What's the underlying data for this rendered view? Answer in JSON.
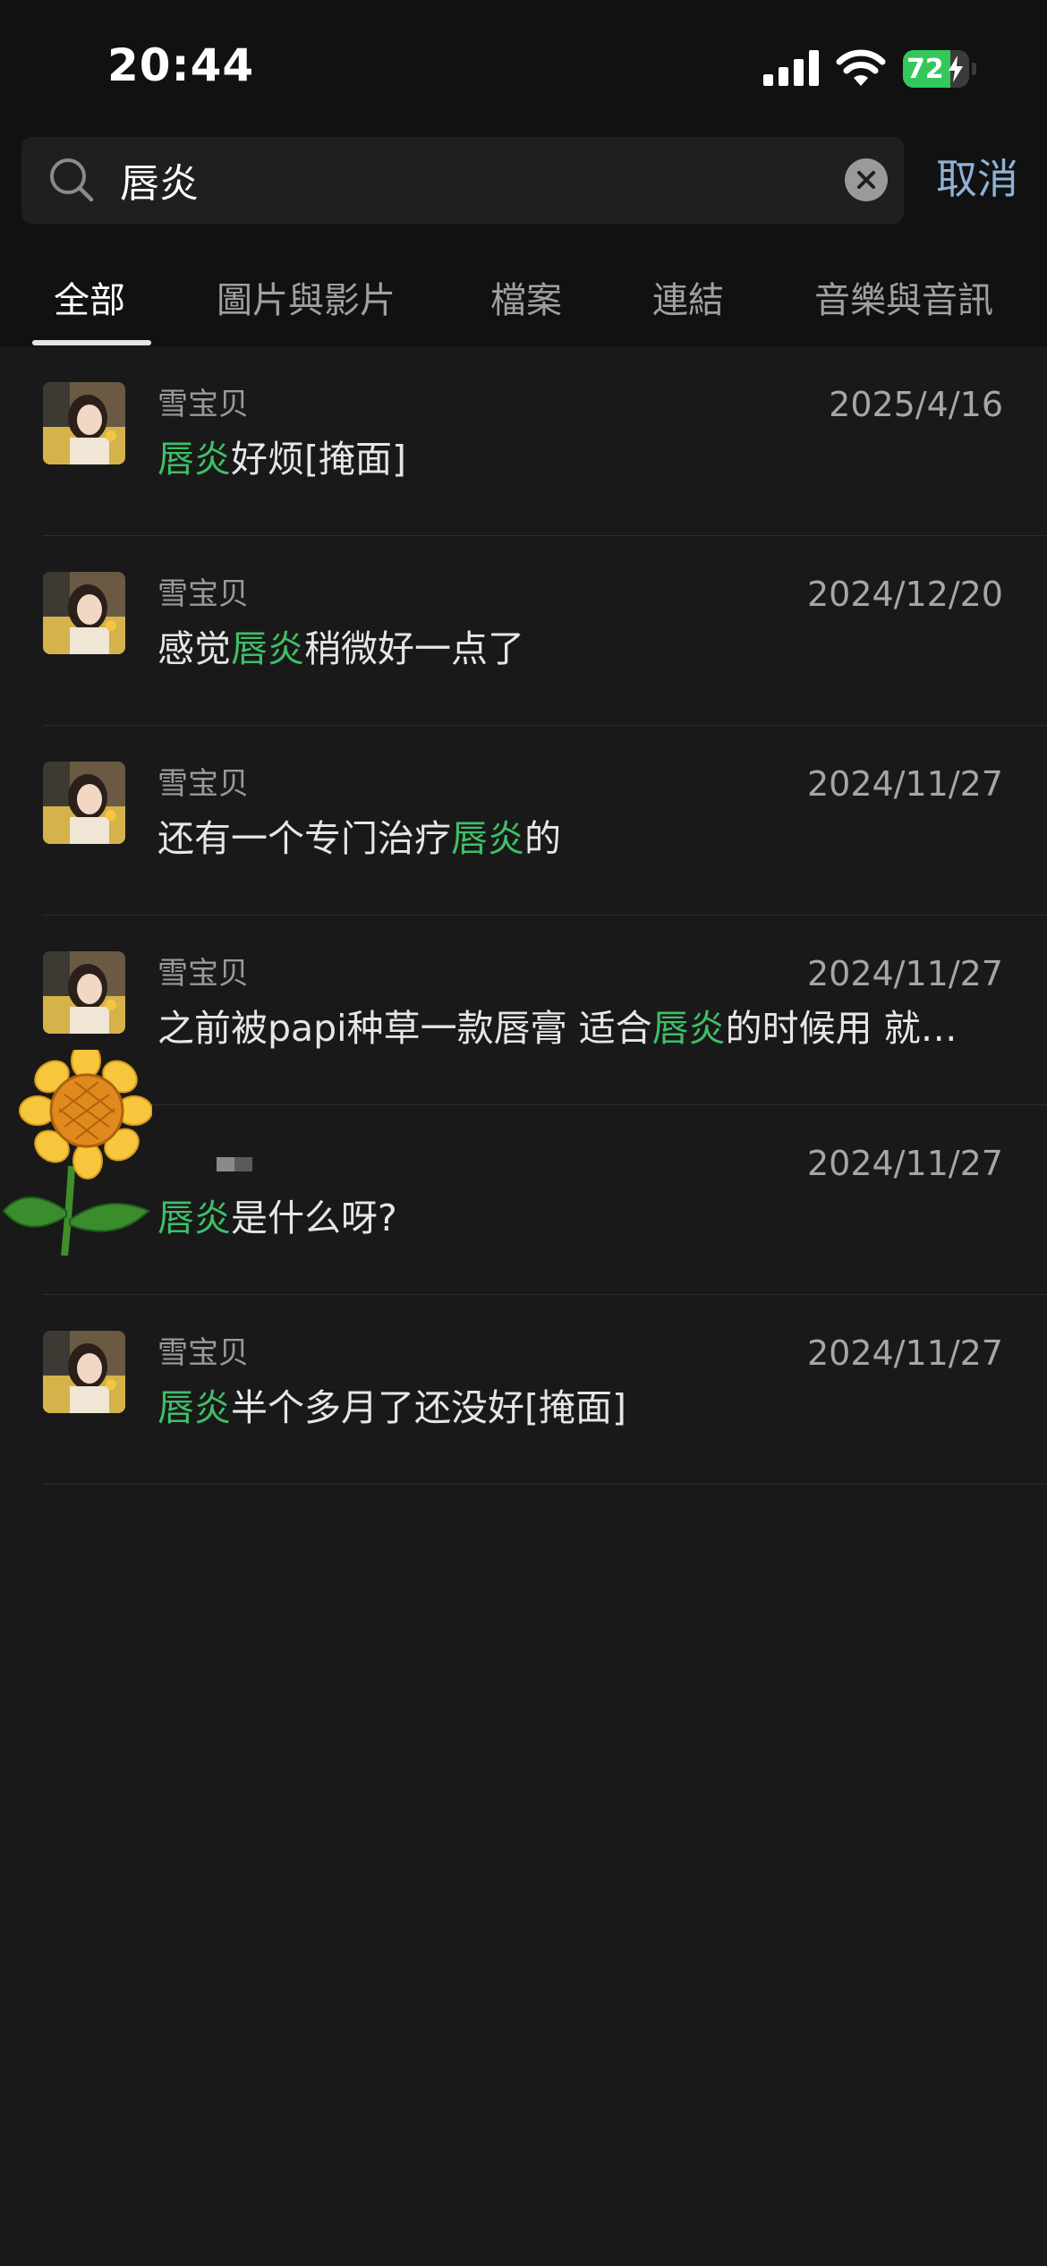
{
  "status_bar": {
    "time": "20:44",
    "battery_level": "72",
    "battery_percent": 72,
    "signal": "cellular-4-bars",
    "wifi": "wifi-full"
  },
  "search": {
    "query": "唇炎",
    "cancel_label": "取消"
  },
  "tabs": [
    {
      "label": "全部",
      "active": true
    },
    {
      "label": "圖片與影片",
      "active": false
    },
    {
      "label": "檔案",
      "active": false
    },
    {
      "label": "連結",
      "active": false
    },
    {
      "label": "音樂與音訊",
      "active": false
    }
  ],
  "results": [
    {
      "sender": "雪宝贝",
      "date": "2025/4/16",
      "message": {
        "before": "",
        "highlight": "唇炎",
        "after": "好烦[掩面]"
      },
      "avatar": "photo-girl-avatar"
    },
    {
      "sender": "雪宝贝",
      "date": "2024/12/20",
      "message": {
        "before": "感觉",
        "highlight": "唇炎",
        "after": "稍微好一点了"
      },
      "avatar": "photo-girl-avatar"
    },
    {
      "sender": "雪宝贝",
      "date": "2024/11/27",
      "message": {
        "before": "还有一个专门治疗",
        "highlight": "唇炎",
        "after": "的"
      },
      "avatar": "photo-girl-avatar"
    },
    {
      "sender": "雪宝贝",
      "date": "2024/11/27",
      "message": {
        "before": "之前被papi种草一款唇膏 适合",
        "highlight": "唇炎",
        "after": "的时候用 就…"
      },
      "avatar": "photo-girl-avatar"
    },
    {
      "sender": "",
      "date": "2024/11/27",
      "message": {
        "before": "",
        "highlight": "唇炎",
        "after": "是什么呀?"
      },
      "avatar": "sunflower-avatar"
    },
    {
      "sender": "雪宝贝",
      "date": "2024/11/27",
      "message": {
        "before": "",
        "highlight": "唇炎",
        "after": "半个多月了还没好[掩面]"
      },
      "avatar": "photo-girl-avatar"
    }
  ],
  "colors": {
    "highlight": "#3fbf67",
    "cancel": "#8fb2d6",
    "battery": "#34c759",
    "background": "#191919"
  }
}
